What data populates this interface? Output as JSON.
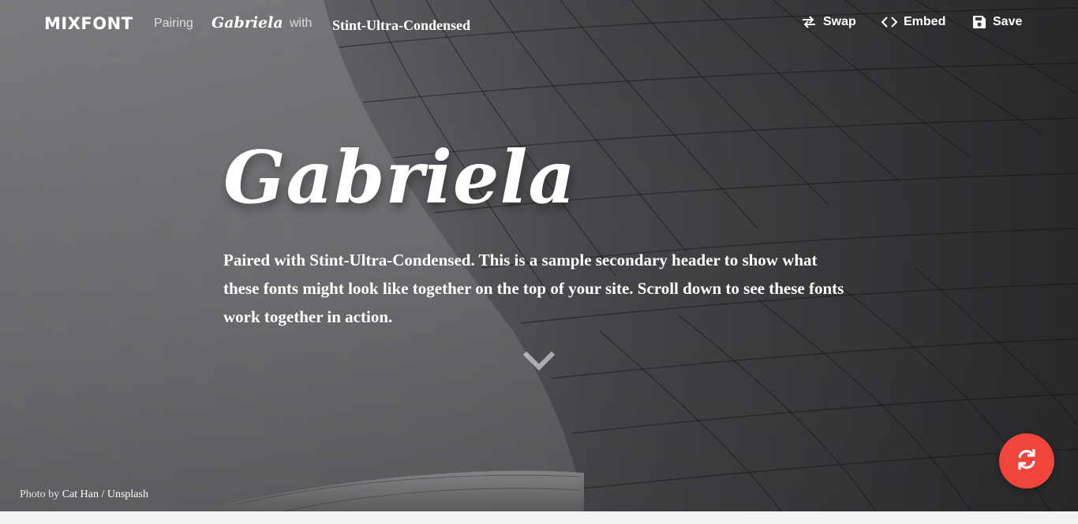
{
  "header": {
    "brand": "MIXFONT",
    "pairing_label": "Pairing",
    "primary_font": "Gabriela",
    "with_label": "with",
    "secondary_font": "Stint-Ultra-Condensed",
    "actions": {
      "swap": "Swap",
      "embed": "Embed",
      "save": "Save"
    }
  },
  "hero": {
    "headline": "Gabriela",
    "subhead": "Paired with Stint-Ultra-Condensed. This is a sample secondary header to show what these fonts might look like together on the top of your site. Scroll down to see these fonts work together in action."
  },
  "credit": {
    "prefix": "Photo by",
    "author": "Cat Han",
    "separator": "/",
    "source": "Unsplash"
  },
  "icons": {
    "swap": "swap-arrows-icon",
    "embed": "code-brackets-icon",
    "save": "floppy-disk-icon",
    "scroll": "chevron-down-icon",
    "refresh": "refresh-icon"
  },
  "colors": {
    "fab": "#f0453a",
    "text": "#ffffff"
  }
}
